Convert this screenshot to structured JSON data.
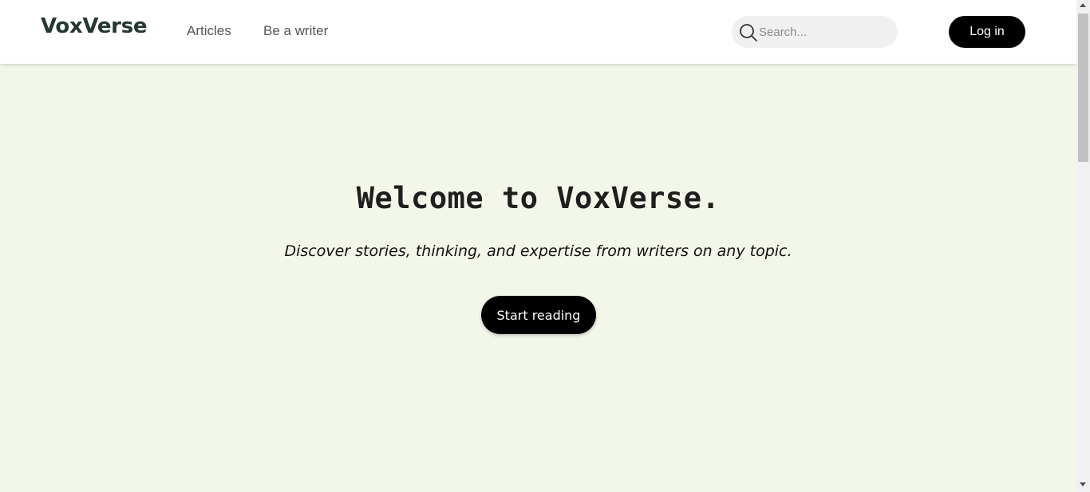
{
  "header": {
    "logo": "VoxVerse",
    "nav": [
      {
        "label": "Articles"
      },
      {
        "label": "Be a writer"
      }
    ],
    "search": {
      "placeholder": "Search...",
      "value": "",
      "icon": "search-icon"
    },
    "login_label": "Log in"
  },
  "hero": {
    "title": "Welcome to VoxVerse.",
    "subtitle": "Discover stories, thinking, and expertise from writers on any topic.",
    "cta_label": "Start reading"
  },
  "colors": {
    "background": "#f3f7ea",
    "header_bg": "#ffffff",
    "logo": "#24382f",
    "button_bg": "#000000",
    "button_text": "#ffffff"
  }
}
